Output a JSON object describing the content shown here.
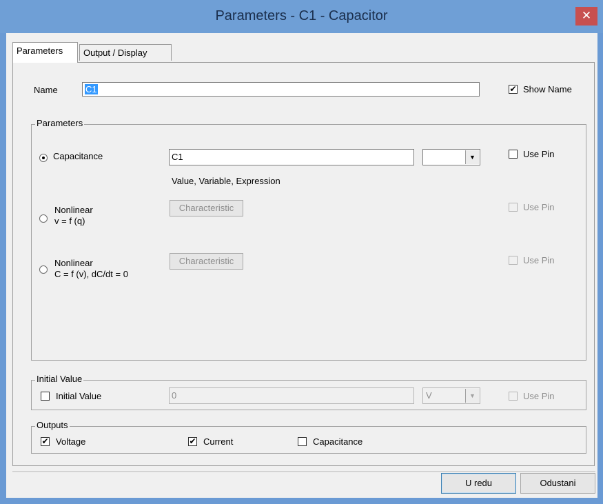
{
  "window": {
    "title": "Parameters - C1 - Capacitor",
    "close_glyph": "✕"
  },
  "tabs": [
    {
      "label": "Parameters"
    },
    {
      "label": "Output / Display"
    }
  ],
  "name_row": {
    "label": "Name",
    "value": "C1",
    "show_name_label": "Show Name",
    "show_name_checked": true
  },
  "parameters_group": {
    "title": "Parameters",
    "capacitance": {
      "label": "Capacitance",
      "value": "C1",
      "unit": "",
      "hint": "Value, Variable, Expression",
      "use_pin_label": "Use Pin"
    },
    "nonlinear_q": {
      "line1": "Nonlinear",
      "line2": "v = f (q)",
      "button_label": "Characteristic",
      "use_pin_label": "Use Pin"
    },
    "nonlinear_v": {
      "line1": "Nonlinear",
      "line2": "C = f (v), dC/dt = 0",
      "button_label": "Characteristic",
      "use_pin_label": "Use Pin"
    }
  },
  "initial_value_group": {
    "title": "Initial Value",
    "checkbox_label": "Initial Value",
    "value": "0",
    "unit": "V",
    "use_pin_label": "Use Pin"
  },
  "outputs_group": {
    "title": "Outputs",
    "voltage_label": "Voltage",
    "voltage_checked": true,
    "current_label": "Current",
    "current_checked": true,
    "capacitance_label": "Capacitance",
    "capacitance_checked": false
  },
  "footer": {
    "ok_label": "U redu",
    "cancel_label": "Odustani"
  },
  "colors": {
    "title_bar": "#6f9fd6",
    "close_button": "#c75050",
    "selection": "#3399ff",
    "dialog_bg": "#f0f0f0"
  }
}
